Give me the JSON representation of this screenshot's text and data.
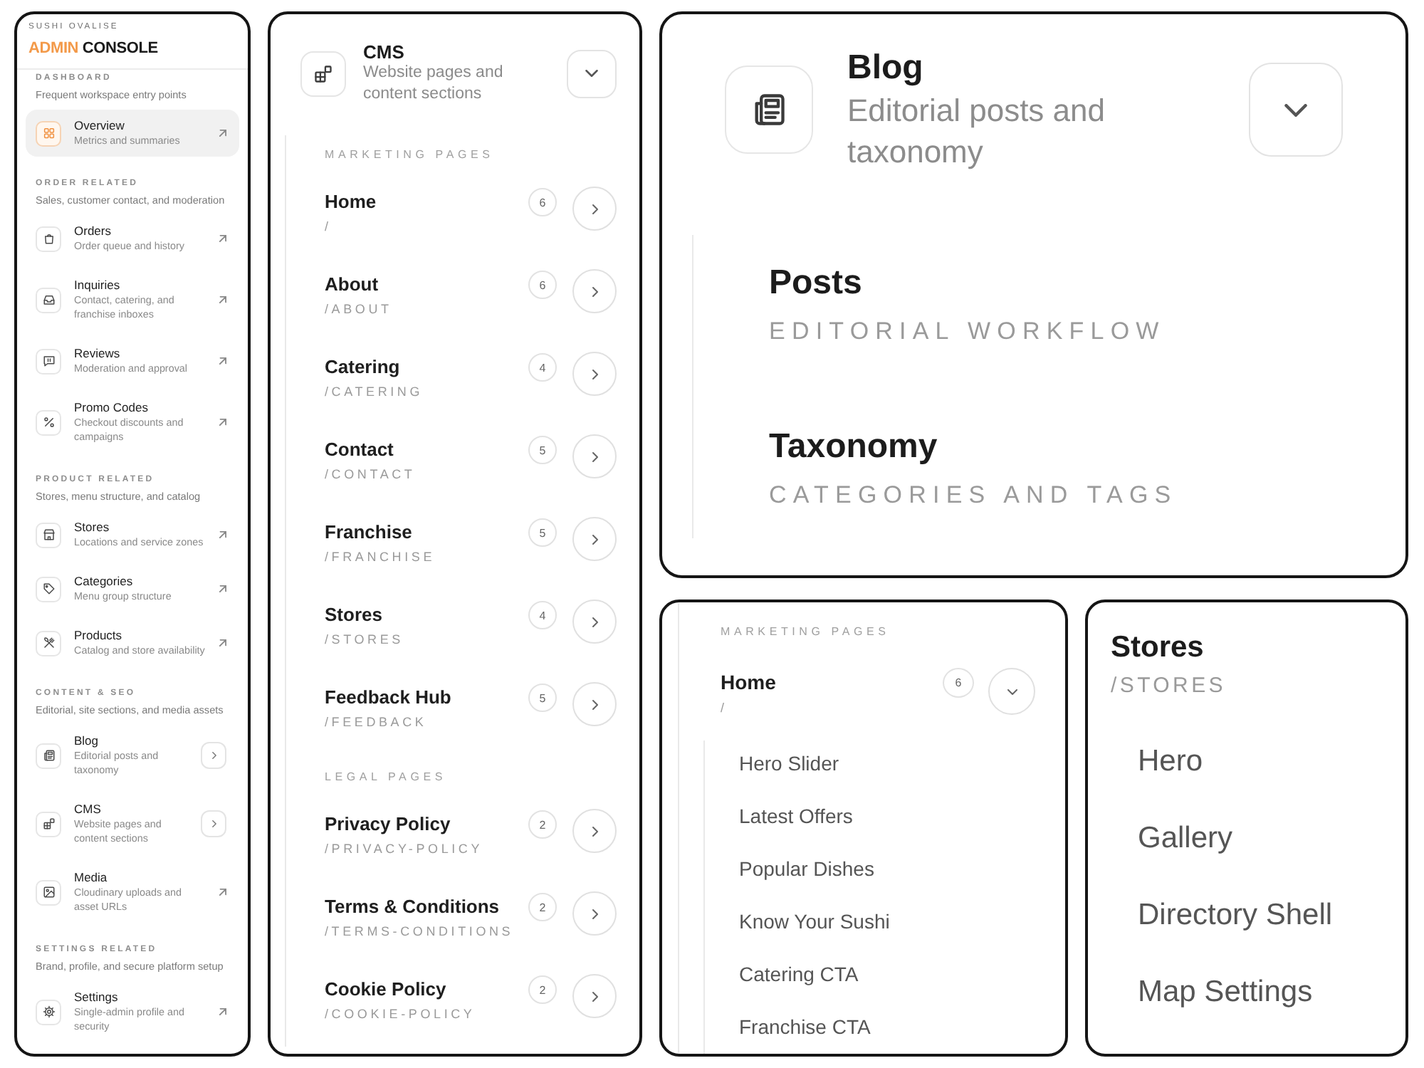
{
  "sidebar": {
    "brand": "SUSHI OVALISE",
    "title_accent": "ADMIN",
    "title": "CONSOLE",
    "sections": [
      {
        "heading": "DASHBOARD",
        "description": "Frequent workspace entry points",
        "items": [
          {
            "label": "Overview",
            "description": "Metrics and summaries",
            "kind": "link",
            "selected": true
          }
        ]
      },
      {
        "heading": "ORDER RELATED",
        "description": "Sales, customer contact, and moderation",
        "items": [
          {
            "label": "Orders",
            "description": "Order queue and history",
            "kind": "link",
            "selected": false
          },
          {
            "label": "Inquiries",
            "description": "Contact, catering, and franchise inboxes",
            "kind": "link",
            "selected": false
          },
          {
            "label": "Reviews",
            "description": "Moderation and approval",
            "kind": "link",
            "selected": false
          },
          {
            "label": "Promo Codes",
            "description": "Checkout discounts and campaigns",
            "kind": "link",
            "selected": false
          }
        ]
      },
      {
        "heading": "PRODUCT RELATED",
        "description": "Stores, menu structure, and catalog",
        "items": [
          {
            "label": "Stores",
            "description": "Locations and service zones",
            "kind": "link",
            "selected": false
          },
          {
            "label": "Categories",
            "description": "Menu group structure",
            "kind": "link",
            "selected": false
          },
          {
            "label": "Products",
            "description": "Catalog and store availability",
            "kind": "link",
            "selected": false
          }
        ]
      },
      {
        "heading": "CONTENT & SEO",
        "description": "Editorial, site sections, and media assets",
        "items": [
          {
            "label": "Blog",
            "description": "Editorial posts and taxonomy",
            "kind": "submenu",
            "selected": false
          },
          {
            "label": "CMS",
            "description": "Website pages and content sections",
            "kind": "submenu",
            "selected": false
          },
          {
            "label": "Media",
            "description": "Cloudinary uploads and asset URLs",
            "kind": "link",
            "selected": false
          }
        ]
      },
      {
        "heading": "SETTINGS RELATED",
        "description": "Brand, profile, and secure platform setup",
        "items": [
          {
            "label": "Settings",
            "description": "Single-admin profile and security",
            "kind": "link",
            "selected": false
          }
        ]
      }
    ]
  },
  "cms_panel": {
    "title": "CMS",
    "description": "Website pages and content sections",
    "expanded": true,
    "groups": [
      {
        "heading": "MARKETING PAGES",
        "pages": [
          {
            "name": "Home",
            "path": "/",
            "count": "6",
            "expanded": false
          },
          {
            "name": "About",
            "path": "/ABOUT",
            "count": "6",
            "expanded": false
          },
          {
            "name": "Catering",
            "path": "/CATERING",
            "count": "4",
            "expanded": false
          },
          {
            "name": "Contact",
            "path": "/CONTACT",
            "count": "5",
            "expanded": false
          },
          {
            "name": "Franchise",
            "path": "/FRANCHISE",
            "count": "5",
            "expanded": false
          },
          {
            "name": "Stores",
            "path": "/STORES",
            "count": "4",
            "expanded": false
          },
          {
            "name": "Feedback Hub",
            "path": "/FEEDBACK",
            "count": "5",
            "expanded": false
          }
        ]
      },
      {
        "heading": "LEGAL PAGES",
        "pages": [
          {
            "name": "Privacy Policy",
            "path": "/PRIVACY-POLICY",
            "count": "2",
            "expanded": false
          },
          {
            "name": "Terms & Conditions",
            "path": "/TERMS-CONDITIONS",
            "count": "2",
            "expanded": false
          },
          {
            "name": "Cookie Policy",
            "path": "/COOKIE-POLICY",
            "count": "2",
            "expanded": false
          }
        ]
      }
    ]
  },
  "blog_panel": {
    "title": "Blog",
    "description": "Editorial posts and taxonomy",
    "expanded": true,
    "children": [
      {
        "label": "Posts",
        "caption": "EDITORIAL WORKFLOW"
      },
      {
        "label": "Taxonomy",
        "caption": "CATEGORIES AND TAGS"
      }
    ]
  },
  "home_panel": {
    "heading": "MARKETING PAGES",
    "page": {
      "name": "Home",
      "path": "/",
      "count": "6",
      "expanded": true,
      "sections": [
        "Hero Slider",
        "Latest Offers",
        "Popular Dishes",
        "Know Your Sushi",
        "Catering CTA",
        "Franchise CTA"
      ]
    }
  },
  "stores_panel": {
    "name": "Stores",
    "path": "/STORES",
    "sections": [
      "Hero",
      "Gallery",
      "Directory Shell",
      "Map Settings"
    ]
  }
}
